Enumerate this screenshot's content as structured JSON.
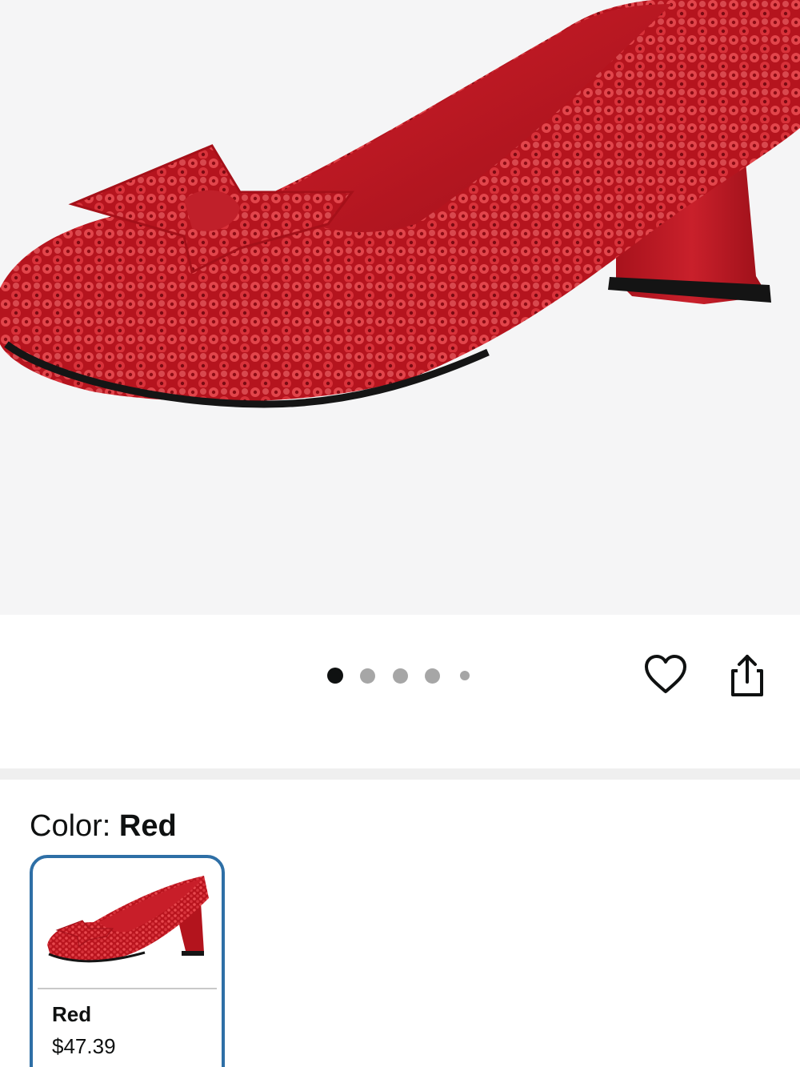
{
  "product": {
    "image_alt": "Red sequin heel pump with bow",
    "carousel": {
      "total": 5,
      "active": 1
    }
  },
  "actions": {
    "wishlist_icon": "heart-icon",
    "share_icon": "share-icon"
  },
  "color": {
    "label": "Color: ",
    "selected": "Red"
  },
  "swatches": [
    {
      "name": "Red",
      "price": "$47.39",
      "selected": true
    }
  ],
  "colors": {
    "selected_border": "#2e6fa6",
    "shoe_red": "#c8202a"
  }
}
